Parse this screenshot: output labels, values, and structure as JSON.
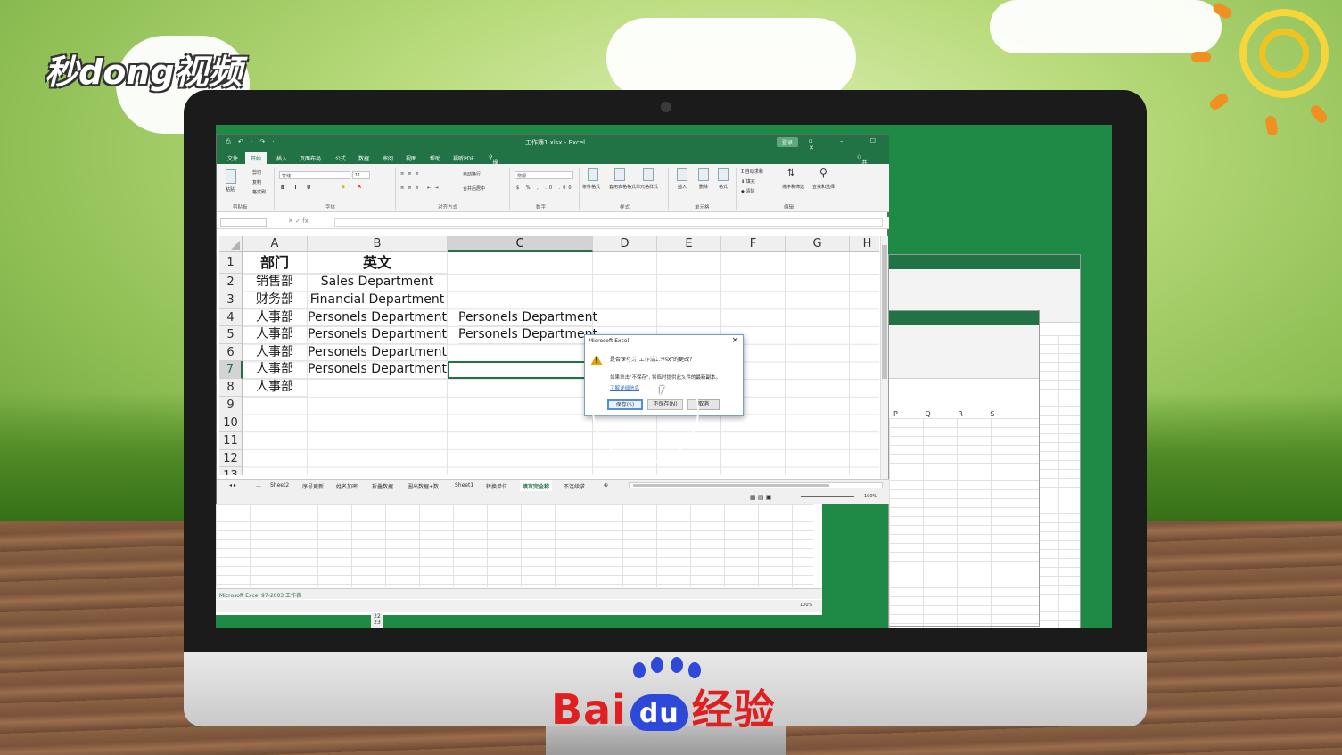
{
  "overlay": {
    "top_logo": "秒dong视频",
    "bottom_logo_left": "Bai",
    "bottom_logo_du": "du",
    "bottom_logo_right": "经验"
  },
  "excel": {
    "title": "工作簿1.xlsx - Excel",
    "signin": "登录",
    "share": "共享",
    "qat": "⎙ ↶ · ↷ ·",
    "tabs": [
      "文件",
      "开始",
      "插入",
      "页面布局",
      "公式",
      "数据",
      "审阅",
      "视图",
      "帮助",
      "福昕PDF",
      "操作说明搜索"
    ],
    "active_tab": "开始",
    "ribbon": {
      "clipboard": {
        "label": "剪贴板",
        "paste": "粘贴",
        "cut": "剪切",
        "copy": "复制",
        "painter": "格式刷"
      },
      "font": {
        "label": "字体",
        "family": "等线",
        "size": "11"
      },
      "alignment": {
        "label": "对齐方式",
        "wrap": "自动换行",
        "merge": "合并后居中"
      },
      "number": {
        "label": "数字",
        "format": "常规"
      },
      "styles": {
        "label": "样式",
        "cond": "条件格式",
        "table": "套用表格格式",
        "cellstyle": "单元格样式"
      },
      "cells": {
        "label": "单元格",
        "insert": "插入",
        "delete": "删除",
        "format": "格式"
      },
      "editing": {
        "label": "编辑",
        "autosum": "自动求和",
        "fill": "填充",
        "clear": "清除",
        "sort": "排序和筛选",
        "find": "查找和选择"
      }
    },
    "columns": [
      "A",
      "B",
      "C",
      "D",
      "E",
      "F",
      "G",
      "H"
    ],
    "rows": [
      "1",
      "2",
      "3",
      "4",
      "5",
      "6",
      "7",
      "8",
      "9",
      "10",
      "11",
      "12",
      "13"
    ],
    "cells": {
      "A1": "部门",
      "B1": "英文",
      "A2": "销售部",
      "B2": "Sales Department",
      "A3": "财务部",
      "B3": "Financial Department",
      "A4": "人事部",
      "B4": "Personels Department",
      "C4": "Personels Department",
      "A5": "人事部",
      "B5": "Personels Department",
      "C5": "Personels Department",
      "A6": "人事部",
      "B6": "Personels Department",
      "A7": "人事部",
      "B7": "Personels Department",
      "A8": "人事部"
    },
    "sheet_tabs": [
      "...",
      "Sheet2",
      "序号更新",
      "姓名加密",
      "折叠数据",
      "圈出数据+数",
      "Sheet1",
      "转换单位",
      "填写完全称",
      "不连续求 ..."
    ],
    "active_sheet": "填写完全称",
    "zoom": "190%"
  },
  "dialog": {
    "title": "Microsoft Excel",
    "question": "是否保存对\"工作簿1.xlsx\"的更改?",
    "message": "如果单击\"不保存\", 将临时提供此文件的最新副本。",
    "link": "了解详细信息",
    "buttons": {
      "save": "保存(S)",
      "dont_save": "不保存(N)",
      "cancel": "取消"
    }
  },
  "background_window": {
    "sheet_tab": "Microsoft Excel 97-2003 工作表",
    "zoom": "100%",
    "cols": [
      "P",
      "Q",
      "R",
      "S"
    ],
    "row_nums": [
      "22",
      "23"
    ]
  }
}
